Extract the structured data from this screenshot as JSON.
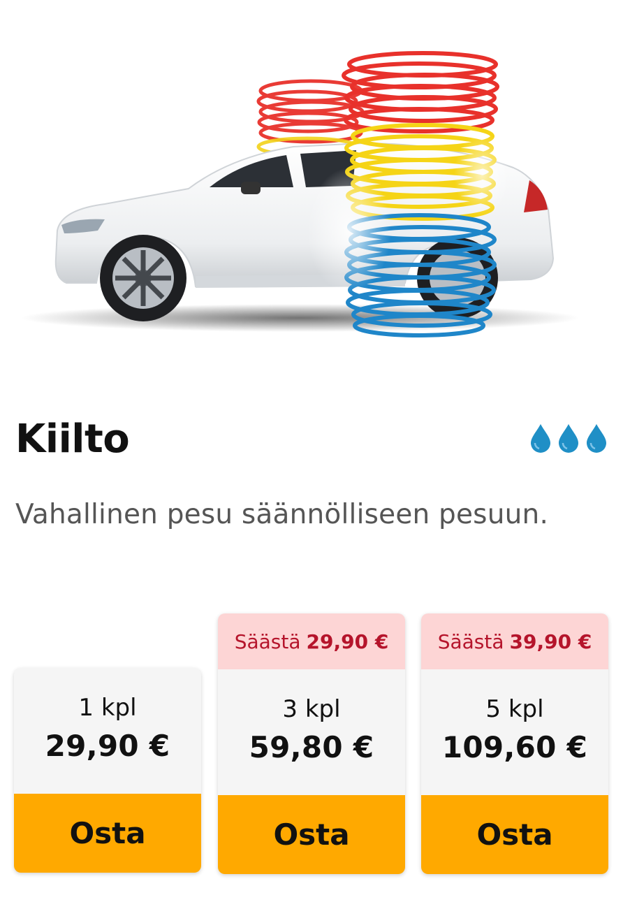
{
  "product": {
    "title": "Kiilto",
    "description": "Vahallinen pesu säännölliseen pesuun.",
    "drop_icons": [
      "water-drop-icon",
      "water-drop-icon",
      "water-drop-icon"
    ],
    "drop_color": "#1f8fc6"
  },
  "packages": [
    {
      "save_prefix": "",
      "save_amount": "",
      "quantity": "1 kpl",
      "price": "29,90 €",
      "buy_label": "Osta"
    },
    {
      "save_prefix": "Säästä",
      "save_amount": "29,90 €",
      "quantity": "3 kpl",
      "price": "59,80 €",
      "buy_label": "Osta"
    },
    {
      "save_prefix": "Säästä",
      "save_amount": "39,90 €",
      "quantity": "5 kpl",
      "price": "109,60 €",
      "buy_label": "Osta"
    }
  ],
  "colors": {
    "buy_button": "#ffa900",
    "save_badge_bg": "#fdd5d5",
    "save_badge_text": "#b5142b"
  }
}
